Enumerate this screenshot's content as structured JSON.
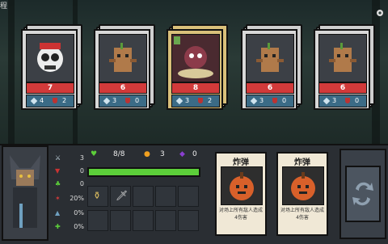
{
  "top_left_label": "程",
  "enemies": [
    {
      "hp": "7",
      "attack": "4",
      "shield": "2",
      "portrait": "skull-clown"
    },
    {
      "hp": "6",
      "attack": "3",
      "shield": "0",
      "portrait": "stump"
    },
    {
      "hp": "8",
      "attack": "3",
      "shield": "2",
      "portrait": "boss-mushroom",
      "selected": true
    },
    {
      "hp": "6",
      "attack": "3",
      "shield": "0",
      "portrait": "stump"
    },
    {
      "hp": "6",
      "attack": "3",
      "shield": "0",
      "portrait": "stump"
    }
  ],
  "player": {
    "stats": [
      {
        "icon": "sword-icon",
        "value": "3"
      },
      {
        "icon": "shield-icon",
        "value": "0"
      },
      {
        "icon": "clover-icon",
        "value": "0"
      },
      {
        "icon": "crit-icon",
        "value": "20%"
      },
      {
        "icon": "boot-icon",
        "value": "0%"
      },
      {
        "icon": "heal-icon",
        "value": "0%"
      }
    ],
    "hp": "8/8",
    "hp_fraction": 1.0,
    "coins": "3",
    "gems": "0"
  },
  "spells": [
    {
      "title": "炸弹",
      "desc": "对场上所有敌人造成4伤害"
    },
    {
      "title": "炸弹",
      "desc": "对场上所有敌人造成4伤害"
    }
  ],
  "colors": {
    "hp": "#d23a3a",
    "shield_bar": "#3b6b86",
    "health_green": "#5ccf3a",
    "coin": "#f0a020",
    "gem": "#8a3fd0"
  }
}
